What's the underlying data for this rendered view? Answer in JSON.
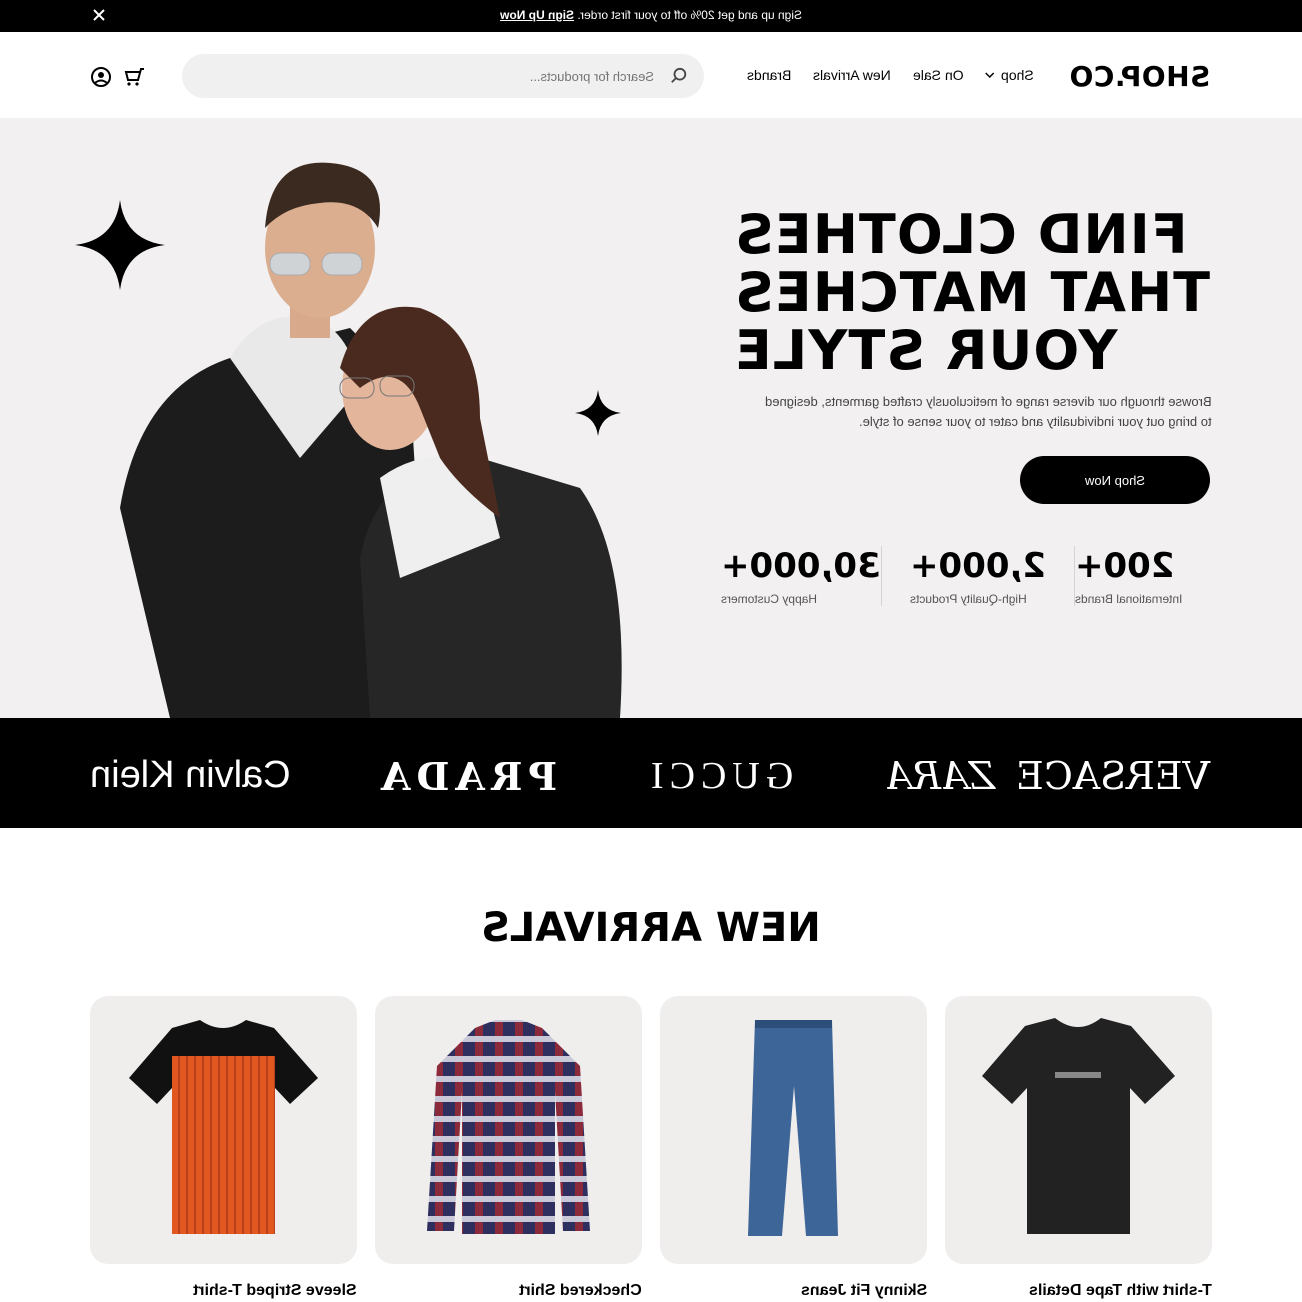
{
  "promo": {
    "message": "Sign up and get 20% off to your first order.",
    "link": "Sign Up Now"
  },
  "header": {
    "brand": "SHOP.CO",
    "nav": [
      "Shop",
      "On Sale",
      "New Arrivals",
      "Brands"
    ],
    "search_placeholder": "Search for products..."
  },
  "hero": {
    "headline": [
      "FIND CLOTHES",
      "THAT MATCHES",
      "YOUR STYLE"
    ],
    "subtext_lines": [
      "Browse through our diverse range of meticulously crafted garments, designed",
      "to bring out your individuality and cater to your sense of style."
    ],
    "cta": "Shop Now",
    "stats": [
      {
        "value": "200+",
        "label": "International Brands"
      },
      {
        "value": "2,000+",
        "label": "High-Quality Products"
      },
      {
        "value": "30,000+",
        "label": "Happy Customers"
      }
    ]
  },
  "brands": [
    "VERSACE",
    "ZARA",
    "GUCCI",
    "PRADA",
    "Calvin Klein"
  ],
  "new_arrivals": {
    "title": "NEW ARRIVALS",
    "products": [
      {
        "name": "T-shirt with Tape Details"
      },
      {
        "name": "Skinny Fit Jeans"
      },
      {
        "name": "Checkered Shirt"
      },
      {
        "name": "Sleeve Striped T-shirt"
      }
    ]
  },
  "colors": {
    "primary": "#000000",
    "hero_bg": "#f2f0f1",
    "card_bg": "#f0eeed"
  }
}
